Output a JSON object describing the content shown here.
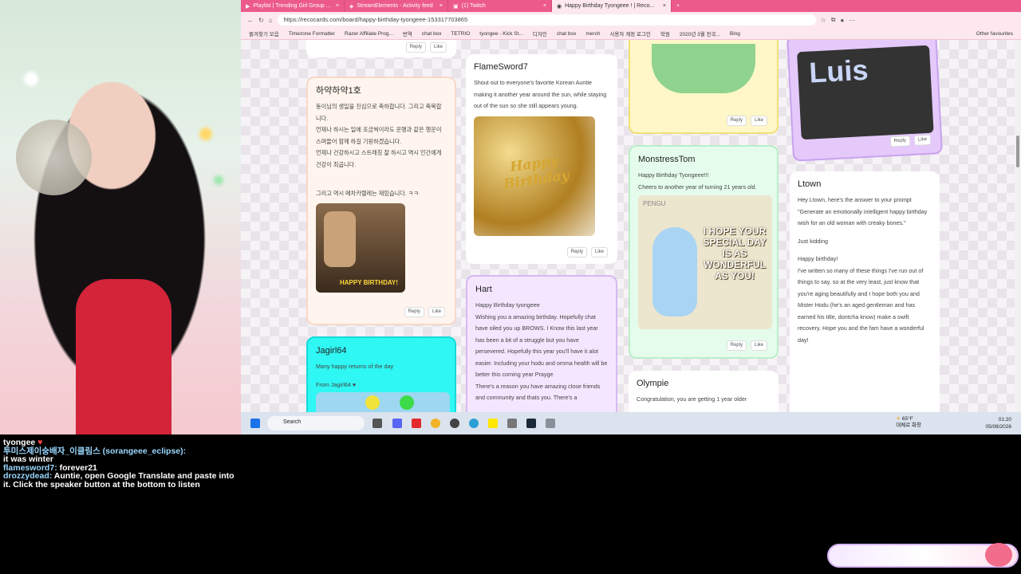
{
  "chat": [
    {
      "user": "tyongee",
      "text": ""
    },
    {
      "user": "투미스제이숭배자_이클림스 (sorangeee_eclipse):",
      "text": "it was winter"
    },
    {
      "user": "flamesword7:",
      "text": "forever21"
    },
    {
      "user": "drozzydead:",
      "text": "Auntie, open Google Translate and paste into it. Click the speaker button at the bottom to listen"
    }
  ],
  "browser": {
    "tabs": [
      {
        "title": "Playlist | Trending Girl Group ..."
      },
      {
        "title": "StreamElements - Activity feed"
      },
      {
        "title": "(1) Twitch"
      },
      {
        "title": "Happy Birthday Tyongeee ! | Reco..."
      }
    ],
    "url": "https://recocards.com/board/happy-birthday-tyongeee-153317703865",
    "bookmarks": [
      "즐겨찾기 모음",
      "Timezone Formatter",
      "Razer Affiliate Prog...",
      "번역",
      "chat box",
      "TETRIO",
      "tyongee - Kick St...",
      "디자인",
      "chat box",
      "merch",
      "사용자 계정 로그인",
      "학원",
      "2020년 3월 전국...",
      "Bing",
      "Other favourites"
    ]
  },
  "cards": {
    "c1": {
      "name": "하약하약1호",
      "body": [
        "동이님의 생일을 진심으로 축하합니다. 그리고 축복합니다.",
        "언제나 하시는 일에 조금씩이라도 운명과 같은 행운이 스며들어 함께 하길 기원하겠습니다.",
        "언제나 건강하시고 스트레칭 잘 하시고 역시 인간에게 건강이 최곱니다.",
        "",
        "그리고 역시 메차카렐레는 재밌습니다. ㅋㅋ"
      ],
      "gif_text": "HAPPY BIRTHDAY!"
    },
    "c2": {
      "name": "FlameSword7",
      "body": "Shout out to everyone's favorite Korean Auntie making it another year around the sun, while staying out of the sun so she still appears young.",
      "img_text": "Happy Birthday"
    },
    "c3": {
      "name": "Hart",
      "body": [
        "Happy Birthday tyongeee",
        "Wishing you a amazing birthday. Hopefully chat have oiled you up BROWS. I Know this last year has been a bit of a struggle but you have persevered. Hopefully this year you'll have it alot easier. Including your  hodu and omma health will be better this coming year Prayge",
        "There's a reason you have amazing close friends and community and thats you. There's a"
      ]
    },
    "c4": {
      "name": "Jagirl64",
      "body": [
        "Many happy returns of the day",
        "From Jagirl64 ♥"
      ]
    },
    "c5": {
      "name": "MonstressTom",
      "body": [
        "Happy Birthday Tyongeee!!!",
        "Cheers to another year of turning 21 years old."
      ],
      "img_brand": "PENGU",
      "img_text": "I HOPE YOUR SPECIAL DAY IS AS WONDERFUL AS YOU!"
    },
    "c6": {
      "name": "Olympie",
      "body": "Congratulation, you are getting 1 year older"
    },
    "c7": {
      "name": "Ltown",
      "body": [
        "Hey Ltown, here's the answer to your prompt \"Generate an emotionally intelligent happy birthday wish for an old woman with creaky bones.\"",
        "Just kidding",
        "Happy birthday!",
        "I've written so many of these things I've run out of things to say, so at the very least, just know that you're aging beautifully and I hope both you and Mister Hodu (he's an aged gentleman and has earned his title, dontcha know) make a swift recovery. Hope you and the fam have a wonderful day!"
      ]
    },
    "c8": {
      "img_text": "Luis"
    }
  },
  "buttons": {
    "reply": "Reply",
    "like": "Like"
  },
  "taskbar": {
    "search": "Search",
    "weather_temp": "65°F",
    "weather_desc": "대체로 화창",
    "time": "01:20",
    "date": "05/08/2026"
  },
  "colors": {
    "tab_bar": "#ec5a8c",
    "page_bg": "#f6f3f6",
    "accent": "#f26d8c"
  }
}
